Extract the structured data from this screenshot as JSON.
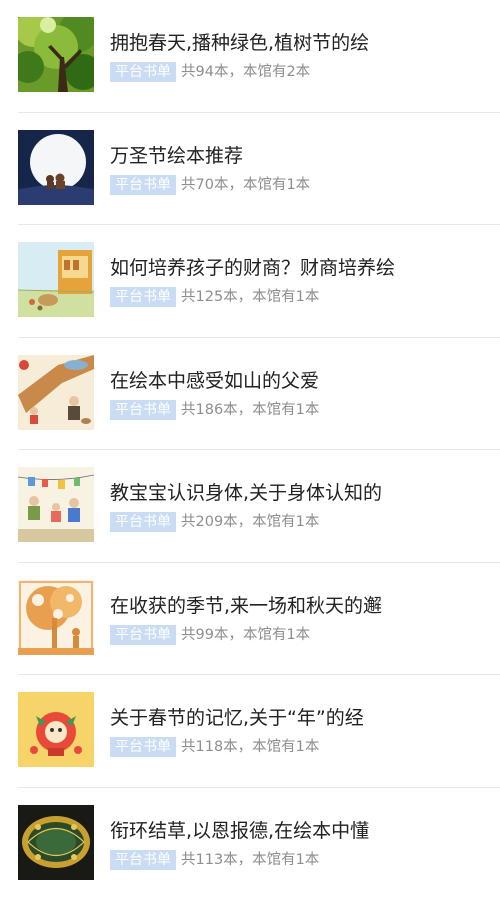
{
  "booklists": [
    {
      "title": "拥抱春天,播种绿色,植树节的绘",
      "badge": "平台书单",
      "count": "共94本，本馆有2本",
      "cover_icon": "tree-canopy-cover"
    },
    {
      "title": "万圣节绘本推荐",
      "badge": "平台书单",
      "count": "共70本，本馆有1本",
      "cover_icon": "moon-night-cover"
    },
    {
      "title": "如何培养孩子的财商？财商培养绘",
      "badge": "平台书单",
      "count": "共125本，本馆有1本",
      "cover_icon": "farm-shop-cover"
    },
    {
      "title": "在绘本中感受如山的父爱",
      "badge": "平台书单",
      "count": "共186本，本馆有1本",
      "cover_icon": "father-child-cover"
    },
    {
      "title": "教宝宝认识身体,关于身体认知的",
      "badge": "平台书单",
      "count": "共209本，本馆有1本",
      "cover_icon": "family-laundry-cover"
    },
    {
      "title": "在收获的季节,来一场和秋天的邂",
      "badge": "平台书单",
      "count": "共99本，本馆有1本",
      "cover_icon": "autumn-papercut-cover"
    },
    {
      "title": "关于春节的记忆,关于“年”的经",
      "badge": "平台书单",
      "count": "共118本，本馆有1本",
      "cover_icon": "spring-festival-cover"
    },
    {
      "title": "衔环结草,以恩报德,在绘本中懂",
      "badge": "平台书单",
      "count": "共113本，本馆有1本",
      "cover_icon": "ornate-frame-cover"
    }
  ]
}
